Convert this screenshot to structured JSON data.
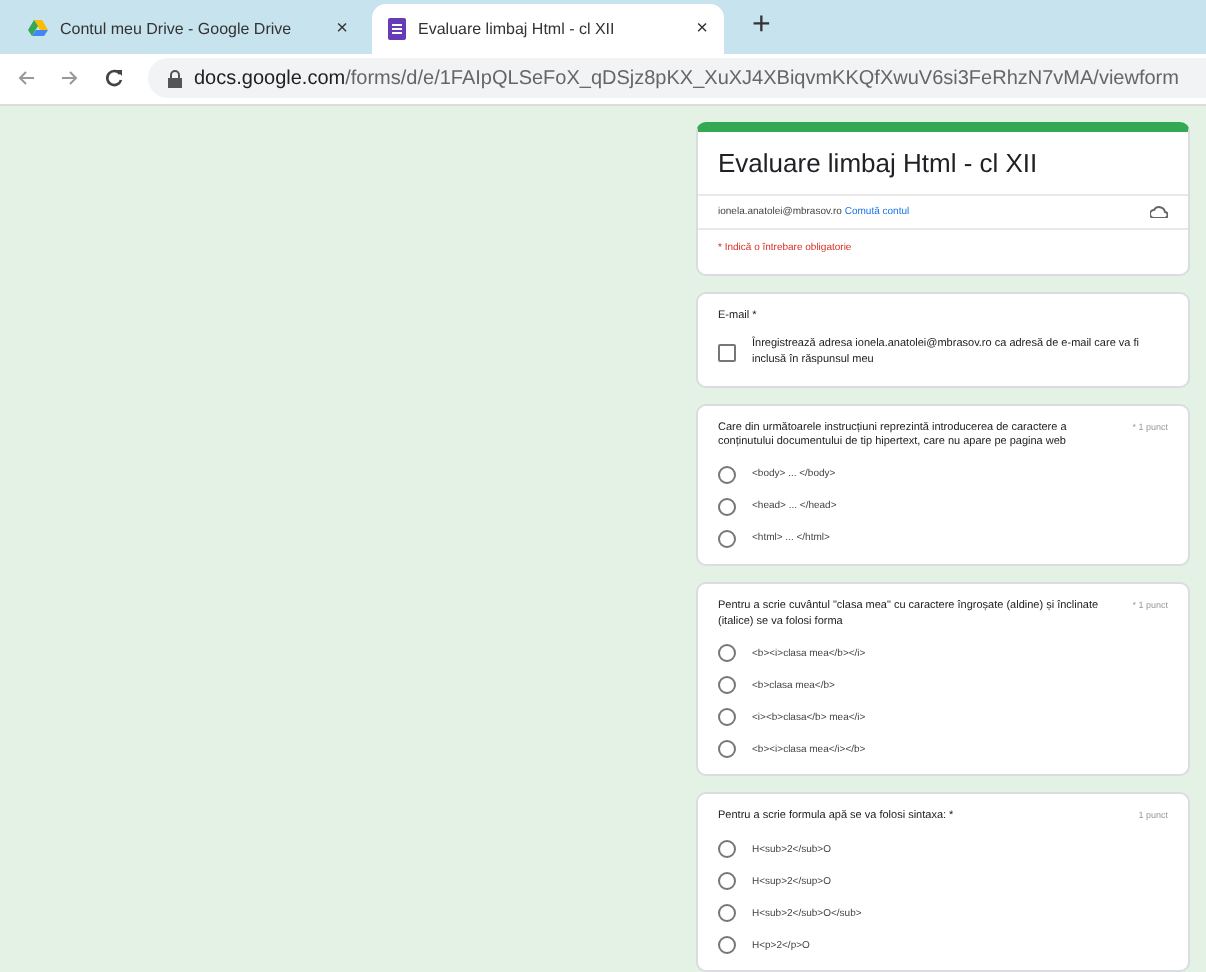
{
  "browser": {
    "tabs": [
      {
        "title": "Contul meu Drive - Google Drive",
        "close": "×",
        "selected": false,
        "kind": "drive"
      },
      {
        "title": "Evaluare limbaj Html - cl XII",
        "close": "×",
        "selected": true,
        "kind": "forms"
      }
    ],
    "new_tab": "+",
    "url_host": "docs.google.com",
    "url_path": "/forms/d/e/1FAIpQLSeFoX_qDSjz8pKX_XuXJ4XBiqvmKKQfXwuV6si3FeRhzN7vMA/viewform"
  },
  "form": {
    "title": "Evaluare limbaj Html - cl XII",
    "account": "ionela.anatolei@mbrasov.ro",
    "switch_account": "Comută contul",
    "required_note": "* Indică o întrebare obligatorie",
    "email": {
      "label": "E-mail *",
      "checked": false,
      "consent": "Înregistrează adresa ionela.anatolei@mbrasov.ro ca adresă de e-mail care va fi inclusă în răspunsul meu"
    },
    "questions": [
      {
        "text": "Care din următoarele instrucțiuni reprezintă introducerea de caractere a conținutului documentului de tip hipertext, care nu apare pe pagina web",
        "points": "* 1 punct",
        "options": [
          {
            "label": "<body> ... </body>",
            "selected": false
          },
          {
            "label": "<head> ... </head>",
            "selected": false
          },
          {
            "label": "<html> ... </html>",
            "selected": false
          }
        ]
      },
      {
        "text": "Pentru a scrie cuvântul \"clasa mea\" cu caractere îngroșate (aldine) și înclinate (italice) se va folosi forma",
        "points": "* 1 punct",
        "options": [
          {
            "label": "<b><i>clasa mea</b></i>",
            "selected": false
          },
          {
            "label": "<b>clasa mea</b>",
            "selected": false
          },
          {
            "label": "<i><b>clasa</b> mea</i>",
            "selected": false
          },
          {
            "label": "<b><i>clasa mea</i></b>",
            "selected": false
          }
        ]
      },
      {
        "text": "Pentru a scrie formula apă se va folosi sintaxa: *",
        "points": "1 punct",
        "options": [
          {
            "label": "H<sub>2</sub>O",
            "selected": false
          },
          {
            "label": "H<sup>2</sup>O",
            "selected": false
          },
          {
            "label": "H<sub>2</sub>O</sub>",
            "selected": false
          },
          {
            "label": "H<p>2</p>O",
            "selected": false
          }
        ]
      }
    ]
  }
}
